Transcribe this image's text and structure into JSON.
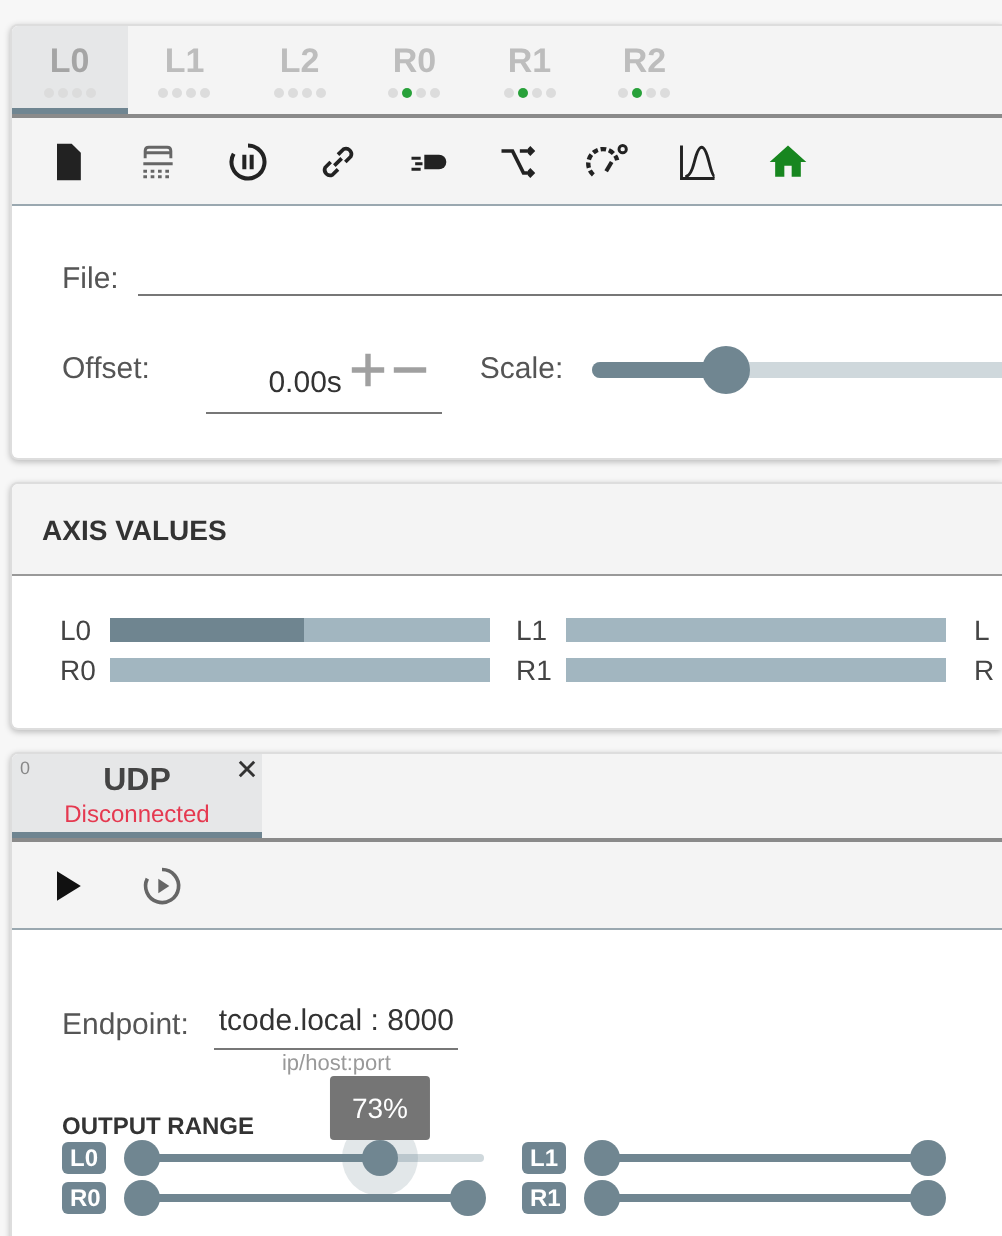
{
  "tabs": [
    {
      "label": "L0",
      "selected": true,
      "dots": [
        {
          "on": false
        },
        {
          "on": false
        },
        {
          "on": false
        },
        {
          "on": false
        }
      ]
    },
    {
      "label": "L1",
      "selected": false,
      "dots": [
        {
          "on": false
        },
        {
          "on": false
        },
        {
          "on": false
        },
        {
          "on": false
        }
      ]
    },
    {
      "label": "L2",
      "selected": false,
      "dots": [
        {
          "on": false
        },
        {
          "on": false
        },
        {
          "on": false
        },
        {
          "on": false
        }
      ]
    },
    {
      "label": "R0",
      "selected": false,
      "dots": [
        {
          "on": false
        },
        {
          "on": true
        },
        {
          "on": false
        },
        {
          "on": false
        }
      ]
    },
    {
      "label": "R1",
      "selected": false,
      "dots": [
        {
          "on": false
        },
        {
          "on": true
        },
        {
          "on": false
        },
        {
          "on": false
        }
      ]
    },
    {
      "label": "R2",
      "selected": false,
      "dots": [
        {
          "on": false
        },
        {
          "on": true
        },
        {
          "on": false
        },
        {
          "on": false
        }
      ]
    }
  ],
  "file": {
    "label": "File:"
  },
  "offset": {
    "label": "Offset:",
    "value": "0.00s"
  },
  "scale": {
    "label": "Scale:",
    "level": 0.33
  },
  "axis_values": {
    "title": "AXIS VALUES",
    "axes": [
      {
        "label": "L0",
        "level": 0.51
      },
      {
        "label": "L1",
        "level": 0
      },
      {
        "label": "L"
      },
      {
        "label": "R0",
        "level": 0
      },
      {
        "label": "R1",
        "level": 0
      },
      {
        "label": "R"
      }
    ]
  },
  "device_tab": {
    "index": "0",
    "title": "UDP",
    "status": "Disconnected",
    "selected": true
  },
  "endpoint": {
    "label": "Endpoint:",
    "value": "tcode.local : 8000",
    "hint": "ip/host:port"
  },
  "output_range": {
    "title": "OUTPUT RANGE",
    "ranges": [
      {
        "label": "L0",
        "low": {
          "level": 0
        },
        "high": {
          "level": 0.73
        },
        "tooltip": "73%"
      },
      {
        "label": "L1",
        "low": {
          "level": 0
        },
        "high": {
          "level": 1
        }
      },
      {
        "label": "R0",
        "low": {
          "level": 0
        },
        "high": {
          "level": 1
        }
      },
      {
        "label": "R1",
        "low": {
          "level": 0
        },
        "high": {
          "level": 1
        }
      }
    ]
  }
}
